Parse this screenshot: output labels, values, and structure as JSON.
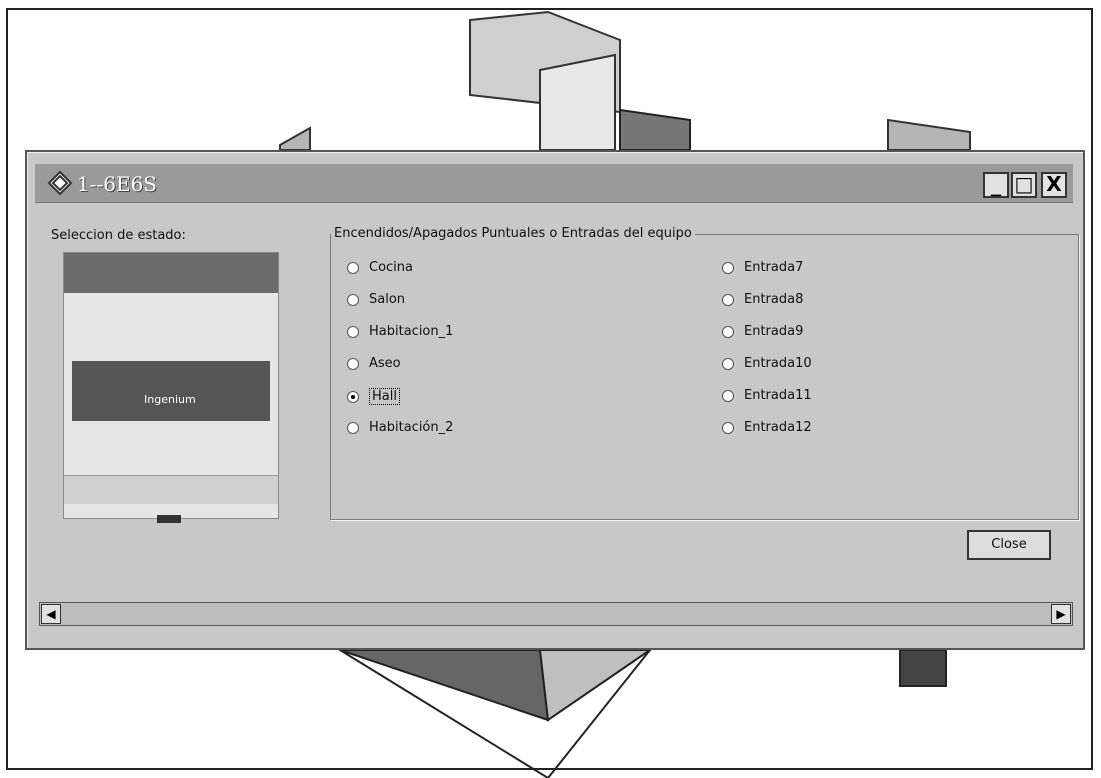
{
  "window": {
    "title": "1--6E6S",
    "controls": {
      "minimize": "_",
      "maximize": "□",
      "close": "X"
    }
  },
  "left_panel": {
    "label": "Seleccion de estado:"
  },
  "device_preview": {
    "brand": "Ingenium"
  },
  "group": {
    "label": "Encendidos/Apagados Puntuales o Entradas del equipo"
  },
  "options_left": [
    {
      "label": "Cocina",
      "selected": false
    },
    {
      "label": "Salon",
      "selected": false
    },
    {
      "label": "Habitacion_1",
      "selected": false
    },
    {
      "label": "Aseo",
      "selected": false
    },
    {
      "label": "Hall",
      "selected": true
    },
    {
      "label": "Habitación_2",
      "selected": false
    }
  ],
  "options_right": [
    {
      "label": "Entrada7",
      "selected": false
    },
    {
      "label": "Entrada8",
      "selected": false
    },
    {
      "label": "Entrada9",
      "selected": false
    },
    {
      "label": "Entrada10",
      "selected": false
    },
    {
      "label": "Entrada11",
      "selected": false
    },
    {
      "label": "Entrada12",
      "selected": false
    }
  ],
  "buttons": {
    "close": "Close"
  },
  "scrollbar": {
    "left": "◀",
    "right": "▶"
  }
}
